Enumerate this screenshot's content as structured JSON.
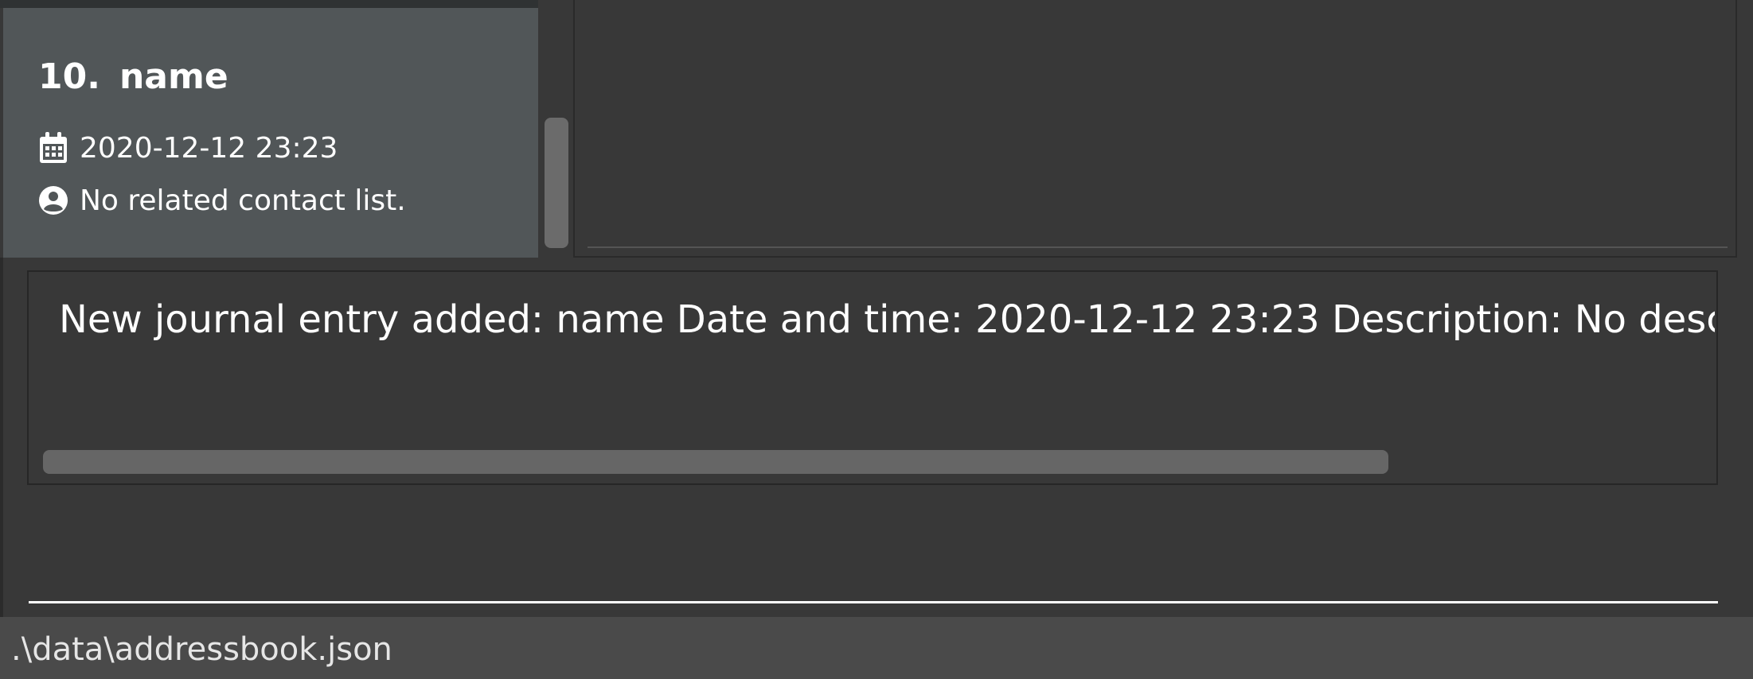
{
  "journal_list": {
    "selected_entry": {
      "index": "10.",
      "name": "name",
      "date_icon": "calendar-icon",
      "datetime": "2020-12-12 23:23",
      "contact_icon": "account-circle-icon",
      "contacts": "No related contact list."
    }
  },
  "result_display": {
    "text": "New journal entry added: name Date and time: 2020-12-12 23:23 Description: No description"
  },
  "command_box": {
    "value": ""
  },
  "status_bar": {
    "save_location": ".\\data\\addressbook.json"
  },
  "colors": {
    "background": "#383838",
    "selected_card": "#515658",
    "status_bar": "#4a4a4a",
    "text": "#ffffff"
  }
}
